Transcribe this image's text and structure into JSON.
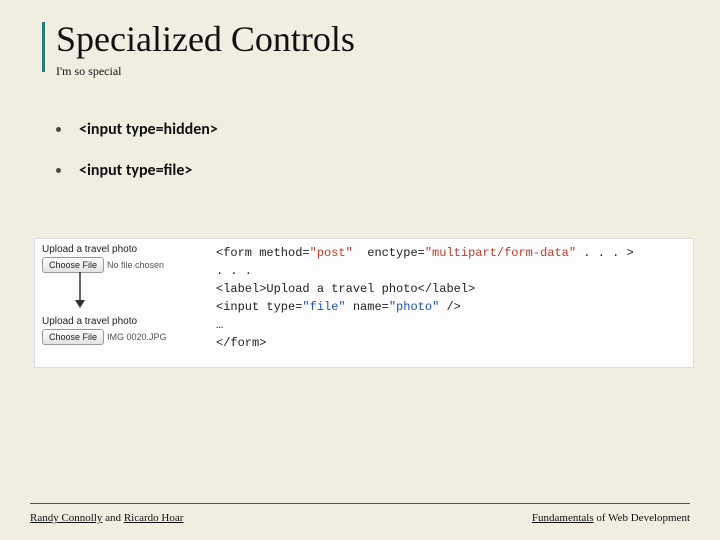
{
  "title": "Specialized Controls",
  "subtitle": "I'm so special",
  "bullets": [
    "<input type=hidden>",
    "<input type=file>"
  ],
  "example": {
    "label1": "Upload a travel photo",
    "button1": "Choose File",
    "file1": "No file chosen",
    "label2": "Upload a travel photo",
    "button2": "Choose File",
    "file2": "IMG 0020.JPG"
  },
  "code": {
    "line1_a": "<form method=",
    "line1_b": "\"post\"",
    "line1_c": "  enctype=",
    "line1_d": "\"multipart/form-data\"",
    "line1_e": " . . . >",
    "line2": ". . .",
    "line3": "<label>Upload a travel photo</label>",
    "line4_a": "<input type=",
    "line4_b": "\"file\"",
    "line4_c": " name=",
    "line4_d": "\"photo\"",
    "line4_e": " />",
    "line5": "…",
    "line6": "</form>"
  },
  "footer": {
    "author1": "Randy Connolly",
    "and": " and ",
    "author2": "Ricardo Hoar",
    "right1": "Fundamentals",
    "right2": " of Web Development"
  }
}
